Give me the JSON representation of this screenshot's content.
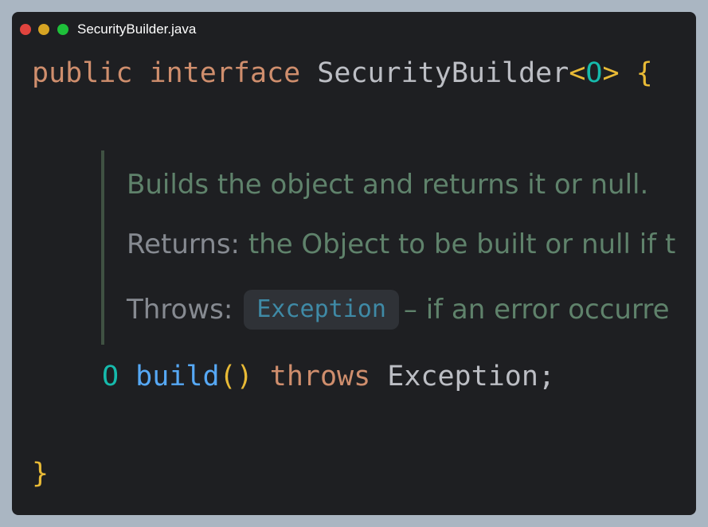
{
  "window": {
    "filename": "SecurityBuilder.java"
  },
  "code": {
    "line1": {
      "kw1": "public",
      "kw2": "interface",
      "name": "SecurityBuilder",
      "lt": "<",
      "tparam": "O",
      "gt": ">",
      "brace": "{"
    },
    "doc": {
      "description": "Builds the object and returns it or null.",
      "returns_label": "Returns:",
      "returns_text": "the Object to be built or null if th",
      "throws_label": "Throws:",
      "throws_exception": "Exception",
      "throws_text": "– if an error occurre"
    },
    "line2": {
      "rtype": "O",
      "method": "build",
      "parens": "()",
      "throws_kw": "throws",
      "exception": "Exception",
      "semicolon": ";"
    },
    "line3": {
      "brace": "}"
    }
  },
  "colors": {
    "background": "#aab6c2",
    "editor": "#1e1f22",
    "keyword": "#cf8e6d",
    "text": "#bcbec4",
    "bracket": "#e8ba36",
    "type_param": "#16baac",
    "method": "#56a8f5",
    "doc_text": "#5f826b",
    "doc_label": "#868a91"
  }
}
